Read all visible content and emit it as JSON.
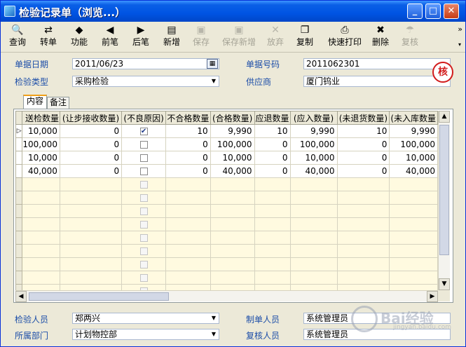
{
  "window": {
    "title": "检验记录单（浏览...）",
    "controls": {
      "minimize": "_",
      "maximize": "□",
      "close": "✕"
    }
  },
  "toolbar": {
    "buttons": [
      {
        "label": "查询",
        "icon": "query-icon",
        "glyph": "🔍",
        "enabled": true
      },
      {
        "label": "转单",
        "icon": "transfer-icon",
        "glyph": "⇄",
        "enabled": true
      },
      {
        "label": "功能",
        "icon": "function-icon",
        "glyph": "◆",
        "enabled": true
      },
      {
        "label": "前笔",
        "icon": "prev-record-icon",
        "glyph": "◀",
        "enabled": true
      },
      {
        "label": "后笔",
        "icon": "next-record-icon",
        "glyph": "▶",
        "enabled": true
      },
      {
        "label": "新增",
        "icon": "new-icon",
        "glyph": "▤",
        "enabled": true
      },
      {
        "label": "保存",
        "icon": "save-icon",
        "glyph": "▣",
        "enabled": false
      },
      {
        "label": "保存新增",
        "icon": "save-new-icon",
        "glyph": "▣",
        "enabled": false
      },
      {
        "label": "放弃",
        "icon": "discard-icon",
        "glyph": "✕",
        "enabled": false
      },
      {
        "label": "复制",
        "icon": "copy-icon",
        "glyph": "❐",
        "enabled": true
      },
      {
        "label": "快速打印",
        "icon": "print-icon",
        "glyph": "⎙",
        "enabled": true
      },
      {
        "label": "删除",
        "icon": "delete-icon",
        "glyph": "✖",
        "enabled": true
      },
      {
        "label": "复核",
        "icon": "review-icon",
        "glyph": "☂",
        "enabled": false
      }
    ],
    "more": "»",
    "more_sub": "▾"
  },
  "header": {
    "doc_date_label": "单据日期",
    "doc_date_value": "2011/06/23",
    "doc_no_label": "单据号码",
    "doc_no_value": "2011062301",
    "inspect_type_label": "检验类型",
    "inspect_type_value": "采购检验",
    "supplier_label": "供应商",
    "supplier_value": "厦门钨业",
    "stamp_text": "核"
  },
  "tabs": [
    {
      "label": "内容",
      "active": true
    },
    {
      "label": "备注",
      "active": false
    }
  ],
  "grid": {
    "columns": [
      "送检数量",
      "(让步接收数量)",
      "(不良原因)",
      "不合格数量",
      "(合格数量)",
      "应退数量",
      "(应入数量)",
      "(未退货数量)",
      "(未入库数量"
    ],
    "current_row_marker": "▷",
    "rows": [
      {
        "qty": "10,000",
        "concession": "0",
        "bad_reason": true,
        "unqualified": "10",
        "qualified": "9,990",
        "should_return": "10",
        "should_in": "9,990",
        "not_returned": "10",
        "not_stored": "9,990"
      },
      {
        "qty": "100,000",
        "concession": "0",
        "bad_reason": false,
        "unqualified": "0",
        "qualified": "100,000",
        "should_return": "0",
        "should_in": "100,000",
        "not_returned": "0",
        "not_stored": "100,000"
      },
      {
        "qty": "10,000",
        "concession": "0",
        "bad_reason": false,
        "unqualified": "0",
        "qualified": "10,000",
        "should_return": "0",
        "should_in": "10,000",
        "not_returned": "0",
        "not_stored": "10,000"
      },
      {
        "qty": "40,000",
        "concession": "0",
        "bad_reason": false,
        "unqualified": "0",
        "qualified": "40,000",
        "should_return": "0",
        "should_in": "40,000",
        "not_returned": "0",
        "not_stored": "40,000"
      }
    ],
    "empty_rows": 9
  },
  "footer": {
    "inspector_label": "检验人员",
    "inspector_value": "郑两兴",
    "dept_label": "所属部门",
    "dept_value": "计划物控部",
    "creator_label": "制单人员",
    "creator_value": "系统管理员",
    "reviewer_label": "复核人员",
    "reviewer_value": "系统管理员"
  },
  "watermark": {
    "text": "Bai经验",
    "sub": "jingyan.baidu.com"
  }
}
